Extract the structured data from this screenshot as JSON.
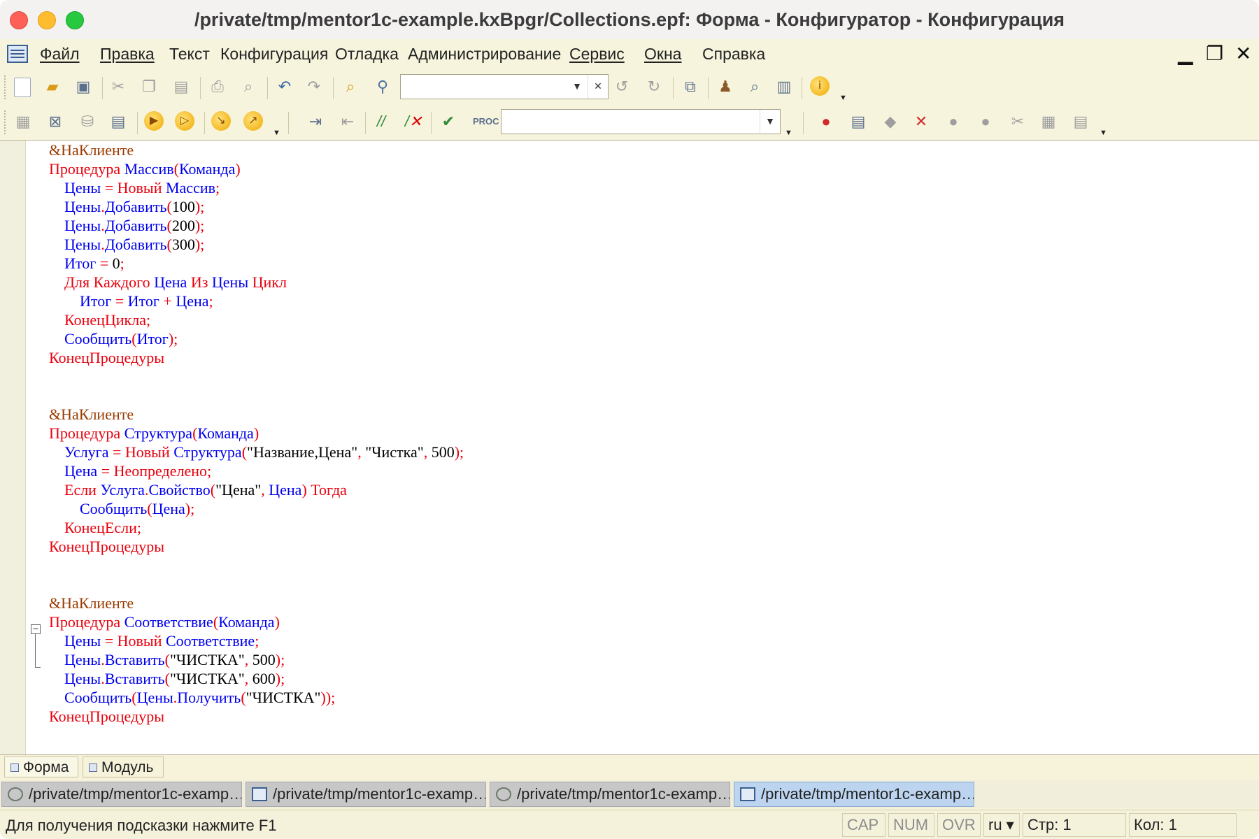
{
  "window": {
    "title": "/private/tmp/mentor1c-example.kxBpgr/Collections.epf: Форма - Конфигуратор - Конфигурация"
  },
  "menu": {
    "items": [
      "Файл",
      "Правка",
      "Текст",
      "Конфигурация",
      "Отладка",
      "Администрирование",
      "Сервис",
      "Окна",
      "Справка"
    ],
    "minimize": "▁",
    "restore": "❐",
    "close": "✕"
  },
  "toolbar1": {
    "search_value": "",
    "find_value": ""
  },
  "toolbar2": {
    "combo_value": ""
  },
  "code": {
    "lines": [
      [
        {
          "t": "&НаКлиенте",
          "c": "dir"
        }
      ],
      [
        {
          "t": "Процедура",
          "c": "kw"
        },
        {
          "t": " ",
          "c": ""
        },
        {
          "t": "Массив",
          "c": "id"
        },
        {
          "t": "(",
          "c": "op"
        },
        {
          "t": "Команда",
          "c": "id"
        },
        {
          "t": ")",
          "c": "op"
        }
      ],
      [
        {
          "t": "    ",
          "c": ""
        },
        {
          "t": "Цены",
          "c": "id"
        },
        {
          "t": " = ",
          "c": "op"
        },
        {
          "t": "Новый",
          "c": "kw"
        },
        {
          "t": " ",
          "c": ""
        },
        {
          "t": "Массив",
          "c": "id"
        },
        {
          "t": ";",
          "c": "op"
        }
      ],
      [
        {
          "t": "    ",
          "c": ""
        },
        {
          "t": "Цены",
          "c": "id"
        },
        {
          "t": ".",
          "c": "op"
        },
        {
          "t": "Добавить",
          "c": "id"
        },
        {
          "t": "(",
          "c": "op"
        },
        {
          "t": "100",
          "c": "num"
        },
        {
          "t": ");",
          "c": "op"
        }
      ],
      [
        {
          "t": "    ",
          "c": ""
        },
        {
          "t": "Цены",
          "c": "id"
        },
        {
          "t": ".",
          "c": "op"
        },
        {
          "t": "Добавить",
          "c": "id"
        },
        {
          "t": "(",
          "c": "op"
        },
        {
          "t": "200",
          "c": "num"
        },
        {
          "t": ");",
          "c": "op"
        }
      ],
      [
        {
          "t": "    ",
          "c": ""
        },
        {
          "t": "Цены",
          "c": "id"
        },
        {
          "t": ".",
          "c": "op"
        },
        {
          "t": "Добавить",
          "c": "id"
        },
        {
          "t": "(",
          "c": "op"
        },
        {
          "t": "300",
          "c": "num"
        },
        {
          "t": ");",
          "c": "op"
        }
      ],
      [
        {
          "t": "    ",
          "c": ""
        },
        {
          "t": "Итог",
          "c": "id"
        },
        {
          "t": " = ",
          "c": "op"
        },
        {
          "t": "0",
          "c": "num"
        },
        {
          "t": ";",
          "c": "op"
        }
      ],
      [
        {
          "t": "    ",
          "c": ""
        },
        {
          "t": "Для Каждого",
          "c": "kw"
        },
        {
          "t": " ",
          "c": ""
        },
        {
          "t": "Цена",
          "c": "id"
        },
        {
          "t": " Из ",
          "c": "kw"
        },
        {
          "t": "Цены",
          "c": "id"
        },
        {
          "t": " Цикл",
          "c": "kw"
        }
      ],
      [
        {
          "t": "        ",
          "c": ""
        },
        {
          "t": "Итог",
          "c": "id"
        },
        {
          "t": " = ",
          "c": "op"
        },
        {
          "t": "Итог",
          "c": "id"
        },
        {
          "t": " + ",
          "c": "op"
        },
        {
          "t": "Цена",
          "c": "id"
        },
        {
          "t": ";",
          "c": "op"
        }
      ],
      [
        {
          "t": "    ",
          "c": ""
        },
        {
          "t": "КонецЦикла;",
          "c": "kw"
        }
      ],
      [
        {
          "t": "    ",
          "c": ""
        },
        {
          "t": "Сообщить",
          "c": "id"
        },
        {
          "t": "(",
          "c": "op"
        },
        {
          "t": "Итог",
          "c": "id"
        },
        {
          "t": ");",
          "c": "op"
        }
      ],
      [
        {
          "t": "КонецПроцедуры",
          "c": "kw"
        }
      ],
      [],
      [],
      [
        {
          "t": "&НаКлиенте",
          "c": "dir"
        }
      ],
      [
        {
          "t": "Процедура",
          "c": "kw"
        },
        {
          "t": " ",
          "c": ""
        },
        {
          "t": "Структура",
          "c": "id"
        },
        {
          "t": "(",
          "c": "op"
        },
        {
          "t": "Команда",
          "c": "id"
        },
        {
          "t": ")",
          "c": "op"
        }
      ],
      [
        {
          "t": "    ",
          "c": ""
        },
        {
          "t": "Услуга",
          "c": "id"
        },
        {
          "t": " = ",
          "c": "op"
        },
        {
          "t": "Новый",
          "c": "kw"
        },
        {
          "t": " ",
          "c": ""
        },
        {
          "t": "Структура",
          "c": "id"
        },
        {
          "t": "(",
          "c": "op"
        },
        {
          "t": "\"Название,Цена\"",
          "c": "str"
        },
        {
          "t": ", ",
          "c": "op"
        },
        {
          "t": "\"Чистка\"",
          "c": "str"
        },
        {
          "t": ", ",
          "c": "op"
        },
        {
          "t": "500",
          "c": "num"
        },
        {
          "t": ");",
          "c": "op"
        }
      ],
      [
        {
          "t": "    ",
          "c": ""
        },
        {
          "t": "Цена",
          "c": "id"
        },
        {
          "t": " = ",
          "c": "op"
        },
        {
          "t": "Неопределено;",
          "c": "kw"
        }
      ],
      [
        {
          "t": "    ",
          "c": ""
        },
        {
          "t": "Если",
          "c": "kw"
        },
        {
          "t": " ",
          "c": ""
        },
        {
          "t": "Услуга",
          "c": "id"
        },
        {
          "t": ".",
          "c": "op"
        },
        {
          "t": "Свойство",
          "c": "id"
        },
        {
          "t": "(",
          "c": "op"
        },
        {
          "t": "\"Цена\"",
          "c": "str"
        },
        {
          "t": ", ",
          "c": "op"
        },
        {
          "t": "Цена",
          "c": "id"
        },
        {
          "t": ")",
          "c": "op"
        },
        {
          "t": " Тогда",
          "c": "kw"
        }
      ],
      [
        {
          "t": "        ",
          "c": ""
        },
        {
          "t": "Сообщить",
          "c": "id"
        },
        {
          "t": "(",
          "c": "op"
        },
        {
          "t": "Цена",
          "c": "id"
        },
        {
          "t": ");",
          "c": "op"
        }
      ],
      [
        {
          "t": "    ",
          "c": ""
        },
        {
          "t": "КонецЕсли;",
          "c": "kw"
        }
      ],
      [
        {
          "t": "КонецПроцедуры",
          "c": "kw"
        }
      ],
      [],
      [],
      [
        {
          "t": "&НаКлиенте",
          "c": "dir"
        }
      ],
      [
        {
          "t": "Процедура",
          "c": "kw"
        },
        {
          "t": " ",
          "c": ""
        },
        {
          "t": "Соответствие",
          "c": "id"
        },
        {
          "t": "(",
          "c": "op"
        },
        {
          "t": "Команда",
          "c": "id"
        },
        {
          "t": ")",
          "c": "op"
        }
      ],
      [
        {
          "t": "    ",
          "c": ""
        },
        {
          "t": "Цены",
          "c": "id"
        },
        {
          "t": " = ",
          "c": "op"
        },
        {
          "t": "Новый",
          "c": "kw"
        },
        {
          "t": " ",
          "c": ""
        },
        {
          "t": "Соответствие",
          "c": "id"
        },
        {
          "t": ";",
          "c": "op"
        }
      ],
      [
        {
          "t": "    ",
          "c": ""
        },
        {
          "t": "Цены",
          "c": "id"
        },
        {
          "t": ".",
          "c": "op"
        },
        {
          "t": "Вставить",
          "c": "id"
        },
        {
          "t": "(",
          "c": "op"
        },
        {
          "t": "\"ЧИСТКА\"",
          "c": "str"
        },
        {
          "t": ", ",
          "c": "op"
        },
        {
          "t": "500",
          "c": "num"
        },
        {
          "t": ");",
          "c": "op"
        }
      ],
      [
        {
          "t": "    ",
          "c": ""
        },
        {
          "t": "Цены",
          "c": "id"
        },
        {
          "t": ".",
          "c": "op"
        },
        {
          "t": "Вставить",
          "c": "id"
        },
        {
          "t": "(",
          "c": "op"
        },
        {
          "t": "\"ЧИСТКА\"",
          "c": "str"
        },
        {
          "t": ", ",
          "c": "op"
        },
        {
          "t": "600",
          "c": "num"
        },
        {
          "t": ");",
          "c": "op"
        }
      ],
      [
        {
          "t": "    ",
          "c": ""
        },
        {
          "t": "Сообщить",
          "c": "id"
        },
        {
          "t": "(",
          "c": "op"
        },
        {
          "t": "Цены",
          "c": "id"
        },
        {
          "t": ".",
          "c": "op"
        },
        {
          "t": "Получить",
          "c": "id"
        },
        {
          "t": "(",
          "c": "op"
        },
        {
          "t": "\"ЧИСТКА\"",
          "c": "str"
        },
        {
          "t": "));",
          "c": "op"
        }
      ],
      [
        {
          "t": "КонецПроцедуры",
          "c": "kw"
        }
      ]
    ]
  },
  "subtabs": [
    "Форма",
    "Модуль"
  ],
  "window_tabs": [
    {
      "label": "/private/tmp/mentor1c-examp…",
      "icon": "gear-icon"
    },
    {
      "label": "/private/tmp/mentor1c-examp…",
      "icon": "form-icon"
    },
    {
      "label": "/private/tmp/mentor1c-examp…",
      "icon": "gear-icon"
    },
    {
      "label": "/private/tmp/mentor1c-examp…",
      "icon": "form-icon"
    }
  ],
  "status": {
    "hint": "Для получения подсказки нажмите F1",
    "cap": "CAP",
    "num": "NUM",
    "ovr": "OVR",
    "lang": "ru ▾",
    "row": "Стр: 1",
    "col": "Кол: 1"
  },
  "colors": {
    "keyword": "#e8000d",
    "identifier": "#0000ee",
    "directive": "#9a3a00",
    "active_tab": "#bcd4ef"
  }
}
